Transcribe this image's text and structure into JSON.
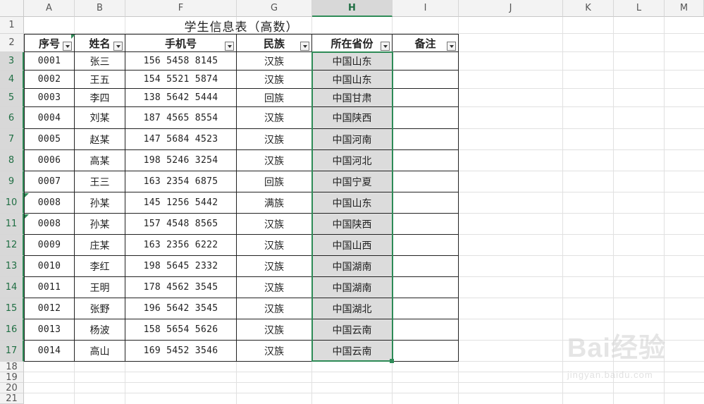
{
  "columns": [
    "A",
    "B",
    "F",
    "G",
    "H",
    "I",
    "J",
    "K",
    "L",
    "M"
  ],
  "rows": [
    "1",
    "2",
    "3",
    "4",
    "5",
    "6",
    "7",
    "8",
    "9",
    "10",
    "11",
    "12",
    "13",
    "14",
    "15",
    "16",
    "17",
    "18",
    "19",
    "20",
    "21"
  ],
  "selected_column": "H",
  "title": "学生信息表（高数）",
  "headers": {
    "seq": "序号",
    "name": "姓名",
    "phone": "手机号",
    "ethnic": "民族",
    "province": "所在省份",
    "note": "备注"
  },
  "records": [
    {
      "seq": "0001",
      "name": "张三",
      "phone": "156 5458 8145",
      "ethnic": "汉族",
      "province": "中国山东",
      "note": ""
    },
    {
      "seq": "0002",
      "name": "王五",
      "phone": "154 5521 5874",
      "ethnic": "汉族",
      "province": "中国山东",
      "note": ""
    },
    {
      "seq": "0003",
      "name": "李四",
      "phone": "138 5642 5444",
      "ethnic": "回族",
      "province": "中国甘肃",
      "note": ""
    },
    {
      "seq": "0004",
      "name": "刘某",
      "phone": "187 4565 8554",
      "ethnic": "汉族",
      "province": "中国陕西",
      "note": ""
    },
    {
      "seq": "0005",
      "name": "赵某",
      "phone": "147 5684 4523",
      "ethnic": "汉族",
      "province": "中国河南",
      "note": ""
    },
    {
      "seq": "0006",
      "name": "高某",
      "phone": "198 5246 3254",
      "ethnic": "汉族",
      "province": "中国河北",
      "note": ""
    },
    {
      "seq": "0007",
      "name": "王三",
      "phone": "163 2354 6875",
      "ethnic": "回族",
      "province": "中国宁夏",
      "note": ""
    },
    {
      "seq": "0008",
      "name": "孙某",
      "phone": "145 1256 5442",
      "ethnic": "满族",
      "province": "中国山东",
      "note": ""
    },
    {
      "seq": "0008",
      "name": "孙某",
      "phone": "157 4548 8565",
      "ethnic": "汉族",
      "province": "中国陕西",
      "note": ""
    },
    {
      "seq": "0009",
      "name": "庄某",
      "phone": "163 2356 6222",
      "ethnic": "汉族",
      "province": "中国山西",
      "note": ""
    },
    {
      "seq": "0010",
      "name": "李红",
      "phone": "198 5645 2332",
      "ethnic": "汉族",
      "province": "中国湖南",
      "note": ""
    },
    {
      "seq": "0011",
      "name": "王明",
      "phone": "178 4562 3545",
      "ethnic": "汉族",
      "province": "中国湖南",
      "note": ""
    },
    {
      "seq": "0012",
      "name": "张野",
      "phone": "196 5642 3545",
      "ethnic": "汉族",
      "province": "中国湖北",
      "note": ""
    },
    {
      "seq": "0013",
      "name": "杨波",
      "phone": "158 5654 5626",
      "ethnic": "汉族",
      "province": "中国云南",
      "note": ""
    },
    {
      "seq": "0014",
      "name": "高山",
      "phone": "169 5452 3546",
      "ethnic": "汉族",
      "province": "中国云南",
      "note": ""
    }
  ],
  "watermark": {
    "brand": "Bai经验",
    "url": "jingyan.baidu.com"
  },
  "colors": {
    "accent": "#2e8b57",
    "selection_fill": "#dcdcdc",
    "header_bg": "#f3f3f3"
  }
}
